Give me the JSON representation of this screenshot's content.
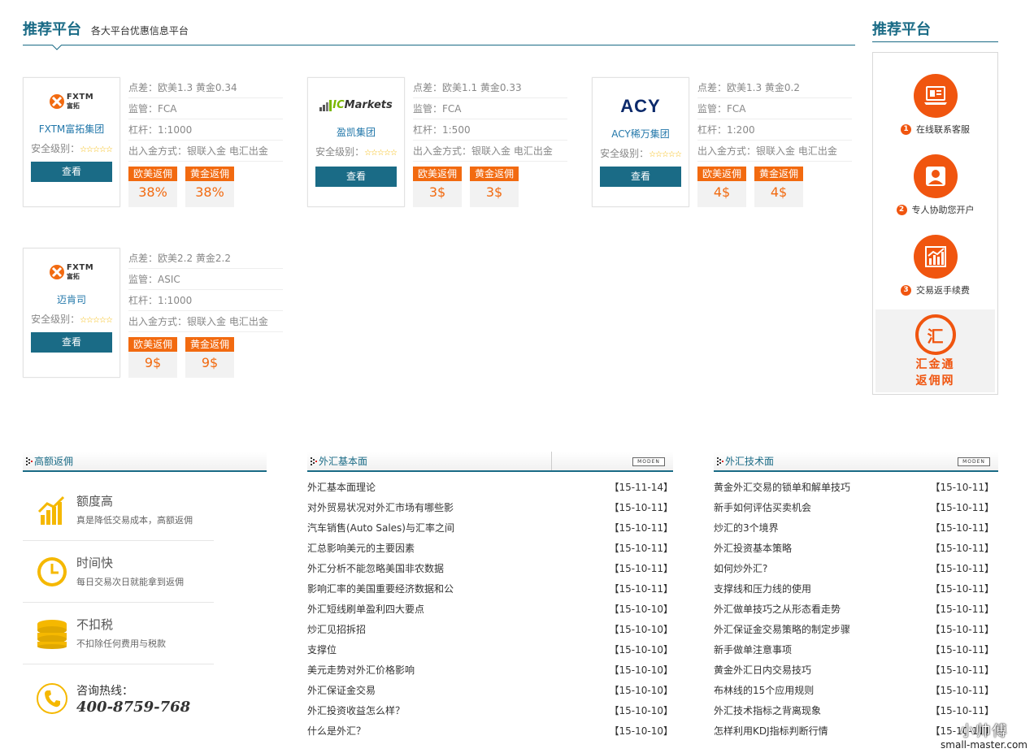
{
  "header": {
    "title": "推荐平台",
    "subtitle": "各大平台优惠信息平台"
  },
  "platforms": [
    {
      "name": "FXTM富拓集团",
      "logo": "fxtm",
      "logo_text": [
        "FXTM",
        "富拓"
      ],
      "safety_label": "安全级别：",
      "stars": "☆☆☆☆☆",
      "view": "查看",
      "spread": "点差：欧美1.3 黄金0.34",
      "regulation": "监管：FCA",
      "leverage": "杠杆：1:1000",
      "funding": "出入金方式：银联入金 电汇出金",
      "rebate_eu_label": "欧美返佣",
      "rebate_eu": "38%",
      "rebate_gold_label": "黄金返佣",
      "rebate_gold": "38%"
    },
    {
      "name": "盈凯集团",
      "logo": "icmarkets",
      "logo_text": [
        "IC",
        "Markets"
      ],
      "safety_label": "安全级别：",
      "stars": "☆☆☆☆☆",
      "view": "查看",
      "spread": "点差：欧美1.1 黄金0.33",
      "regulation": "监管：FCA",
      "leverage": "杠杆：1:500",
      "funding": "出入金方式：银联入金 电汇出金",
      "rebate_eu_label": "欧美返佣",
      "rebate_eu": "3$",
      "rebate_gold_label": "黄金返佣",
      "rebate_gold": "3$"
    },
    {
      "name": "ACY稀万集团",
      "logo": "acy",
      "logo_text": [
        "ACY"
      ],
      "safety_label": "安全级别：",
      "stars": "☆☆☆☆☆",
      "view": "查看",
      "spread": "点差：欧美1.3 黄金0.2",
      "regulation": "监管：FCA",
      "leverage": "杠杆：1:200",
      "funding": "出入金方式：银联入金 电汇出金",
      "rebate_eu_label": "欧美返佣",
      "rebate_eu": "4$",
      "rebate_gold_label": "黄金返佣",
      "rebate_gold": "4$"
    },
    {
      "name": "迈肯司",
      "logo": "fxtm",
      "logo_text": [
        "FXTM",
        "富拓"
      ],
      "safety_label": "安全级别：",
      "stars": "☆☆☆☆☆",
      "view": "查看",
      "spread": "点差：欧美2.2 黄金2.2",
      "regulation": "监管：ASIC",
      "leverage": "杠杆：1:1000",
      "funding": "出入金方式：银联入金 电汇出金",
      "rebate_eu_label": "欧美返佣",
      "rebate_eu": "9$",
      "rebate_gold_label": "黄金返佣",
      "rebate_gold": "9$"
    }
  ],
  "sidebar": {
    "title": "推荐平台",
    "steps": [
      {
        "num": "1",
        "label": "在线联系客服",
        "icon": "computer-icon"
      },
      {
        "num": "2",
        "label": "专人协助您开户",
        "icon": "person-icon"
      },
      {
        "num": "3",
        "label": "交易返手续费",
        "icon": "bar-chart-icon"
      }
    ],
    "brand_char": "汇",
    "brand_line1": "汇金通",
    "brand_line2": "返佣网"
  },
  "panels": {
    "features": {
      "title": "高额返佣",
      "items": [
        {
          "t1": "额度高",
          "t2": "真是降低交易成本，高额返佣",
          "icon": "bar-chart-icon"
        },
        {
          "t1": "时间快",
          "t2": "每日交易次日就能拿到返佣",
          "icon": "clock-icon"
        },
        {
          "t1": "不扣税",
          "t2": "不扣除任何费用与税款",
          "icon": "coins-icon"
        }
      ],
      "hotline_label": "咨询热线：",
      "hotline_number": "400-8759-768"
    },
    "fundamentals": {
      "title": "外汇基本面",
      "more": "MODEN",
      "items": [
        {
          "title": "外汇基本面理论",
          "date": "【15-11-14】"
        },
        {
          "title": "对外贸易状况对外汇市场有哪些影",
          "date": "【15-10-11】"
        },
        {
          "title": "汽车销售(Auto Sales)与汇率之间",
          "date": "【15-10-11】"
        },
        {
          "title": "汇总影响美元的主要因素",
          "date": "【15-10-11】"
        },
        {
          "title": "外汇分析不能忽略美国非农数据",
          "date": "【15-10-11】"
        },
        {
          "title": "影响汇率的美国重要经济数据和公",
          "date": "【15-10-11】"
        },
        {
          "title": "外汇短线刷单盈利四大要点",
          "date": "【15-10-10】"
        },
        {
          "title": "炒汇见招拆招",
          "date": "【15-10-10】"
        },
        {
          "title": "支撑位",
          "date": "【15-10-10】"
        },
        {
          "title": "美元走势对外汇价格影响",
          "date": "【15-10-10】"
        },
        {
          "title": "外汇保证金交易",
          "date": "【15-10-10】"
        },
        {
          "title": "外汇投资收益怎么样？",
          "date": "【15-10-10】"
        },
        {
          "title": "什么是外汇？",
          "date": "【15-10-10】"
        }
      ]
    },
    "technical": {
      "title": "外汇技术面",
      "more": "MODEN",
      "items": [
        {
          "title": "黄金外汇交易的锁单和解单技巧",
          "date": "【15-10-11】"
        },
        {
          "title": "新手如何评估买卖机会",
          "date": "【15-10-11】"
        },
        {
          "title": "炒汇的3个境界",
          "date": "【15-10-11】"
        },
        {
          "title": "外汇投资基本策略",
          "date": "【15-10-11】"
        },
        {
          "title": "如何炒外汇?",
          "date": "【15-10-11】"
        },
        {
          "title": "支撑线和压力线的使用",
          "date": "【15-10-11】"
        },
        {
          "title": "外汇做单技巧之从形态看走势",
          "date": "【15-10-11】"
        },
        {
          "title": "外汇保证金交易策略的制定步骤",
          "date": "【15-10-11】"
        },
        {
          "title": "新手做单注意事项",
          "date": "【15-10-11】"
        },
        {
          "title": "黄金外汇日内交易技巧",
          "date": "【15-10-11】"
        },
        {
          "title": "布林线的15个应用规则",
          "date": "【15-10-11】"
        },
        {
          "title": "外汇技术指标之背离现象",
          "date": "【15-10-11】"
        },
        {
          "title": "怎样利用KDJ指标判断行情",
          "date": "【15-10-11】"
        }
      ]
    }
  },
  "watermark": {
    "line1": "小帅傅",
    "line2": "small-master.com"
  },
  "colors": {
    "primary": "#1a6b86",
    "accent": "#f26a10",
    "link": "#2277aa"
  }
}
